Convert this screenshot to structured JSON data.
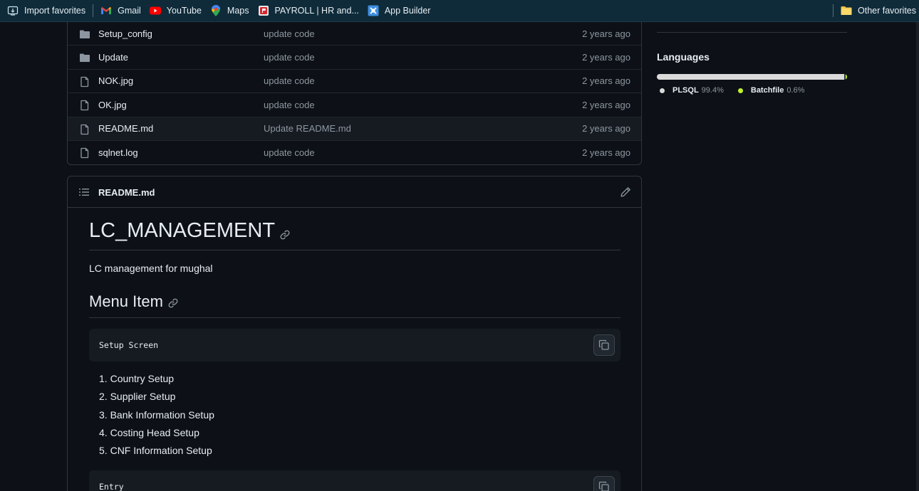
{
  "bookmarks": {
    "items": [
      {
        "label": "Import favorites",
        "icon": "import-icon"
      },
      {
        "label": "Gmail",
        "icon": "gmail-icon"
      },
      {
        "label": "YouTube",
        "icon": "youtube-icon"
      },
      {
        "label": "Maps",
        "icon": "maps-pin-icon"
      },
      {
        "label": "PAYROLL | HR and...",
        "icon": "payroll-icon"
      },
      {
        "label": "App Builder",
        "icon": "app-builder-icon"
      }
    ],
    "other": {
      "label": "Other favorites",
      "icon": "folder-icon"
    }
  },
  "files": [
    {
      "type": "folder",
      "name": "Setup_config",
      "message": "update code",
      "age": "2 years ago"
    },
    {
      "type": "folder",
      "name": "Update",
      "message": "update code",
      "age": "2 years ago"
    },
    {
      "type": "file",
      "name": "NOK.jpg",
      "message": "update code",
      "age": "2 years ago"
    },
    {
      "type": "file",
      "name": "OK.jpg",
      "message": "update code",
      "age": "2 years ago"
    },
    {
      "type": "file",
      "name": "README.md",
      "message": "Update README.md",
      "age": "2 years ago"
    },
    {
      "type": "file",
      "name": "sqlnet.log",
      "message": "update code",
      "age": "2 years ago"
    }
  ],
  "readme": {
    "filename": "README.md",
    "h1": "LC_MANAGEMENT",
    "intro": "LC management for mughal",
    "h2": "Menu Item",
    "code1": "Setup Screen",
    "list": [
      "Country Setup",
      "Supplier Setup",
      "Bank Information Setup",
      "Costing Head Setup",
      "CNF Information Setup"
    ],
    "code2": "Entry"
  },
  "languages": {
    "title": "Languages",
    "items": [
      {
        "name": "PLSQL",
        "percent": "99.4%",
        "value": 99.4,
        "color": "#dadada"
      },
      {
        "name": "Batchfile",
        "percent": "0.6%",
        "value": 0.6,
        "color": "#c1f12e"
      }
    ]
  }
}
